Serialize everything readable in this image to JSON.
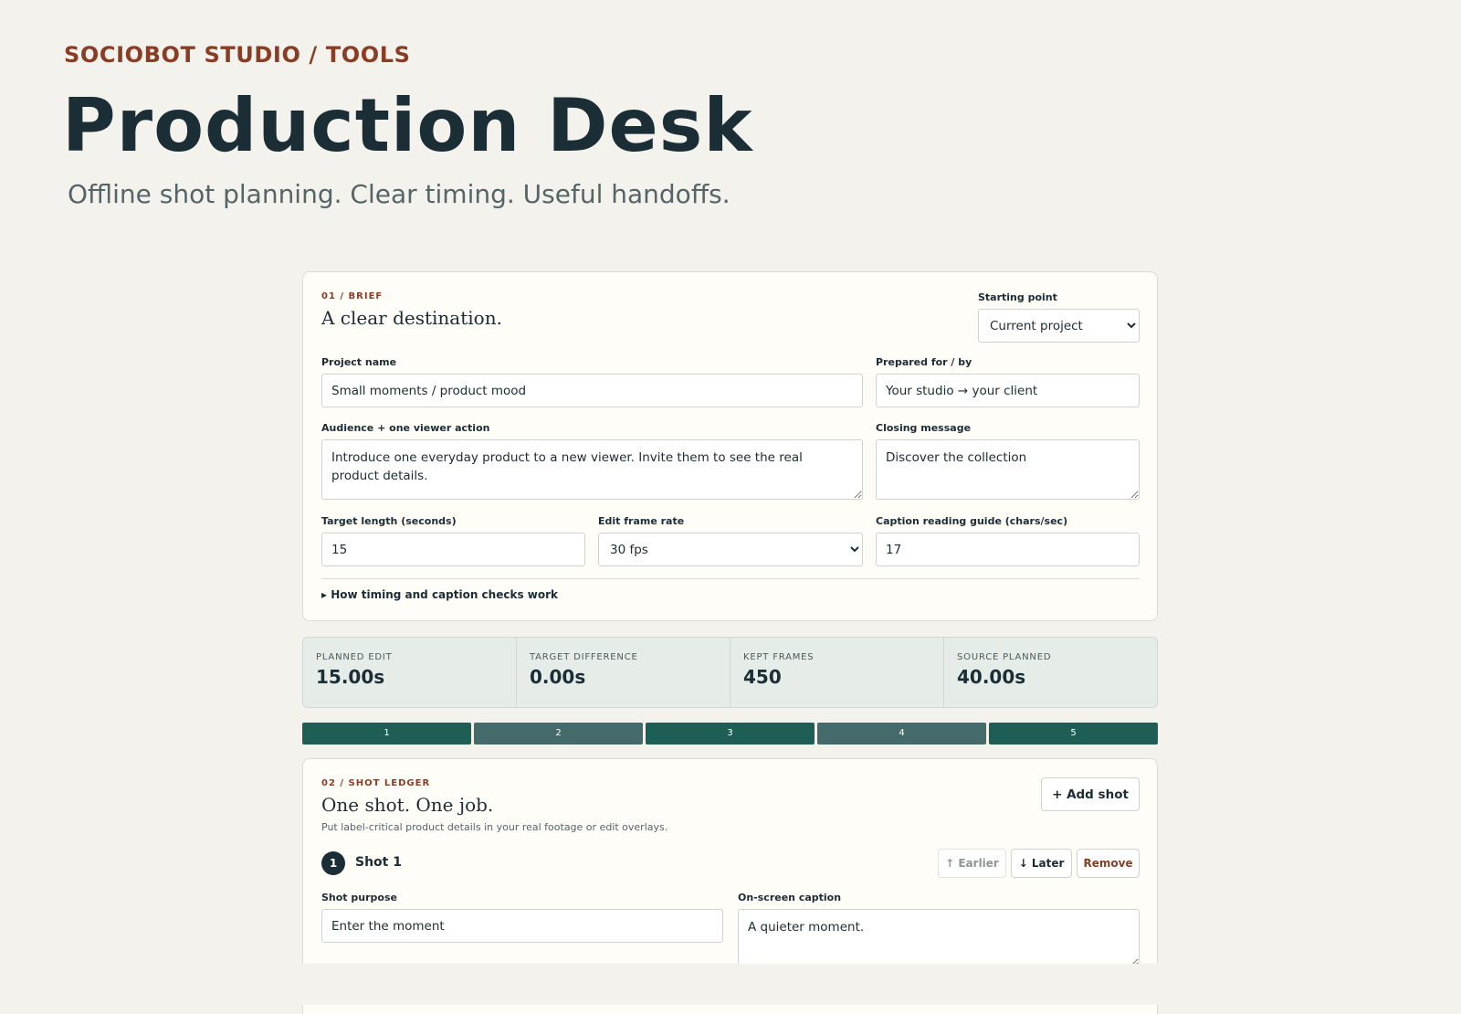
{
  "header": {
    "eyebrow": "SOCIOBOT STUDIO / TOOLS",
    "title": "Production Desk",
    "subtitle": "Offline shot planning. Clear timing. Useful handoffs."
  },
  "brief": {
    "section_label": "01 / BRIEF",
    "heading": "A clear destination.",
    "starting_point": {
      "label": "Starting point",
      "value": "Current project"
    },
    "project_name": {
      "label": "Project name",
      "value": "Small moments / product mood"
    },
    "prepared": {
      "label": "Prepared for / by",
      "value": "Your studio → your client"
    },
    "audience": {
      "label": "Audience + one viewer action",
      "value": "Introduce one everyday product to a new viewer. Invite them to see the real product details."
    },
    "closing": {
      "label": "Closing message",
      "value": "Discover the collection"
    },
    "target_length": {
      "label": "Target length (seconds)",
      "value": "15"
    },
    "frame_rate": {
      "label": "Edit frame rate",
      "value": "30 fps"
    },
    "caption_guide": {
      "label": "Caption reading guide (chars/sec)",
      "value": "17"
    },
    "details_toggle": "▸ How timing and caption checks work"
  },
  "stats": [
    {
      "label": "PLANNED EDIT",
      "value": "15.00s"
    },
    {
      "label": "TARGET DIFFERENCE",
      "value": "0.00s"
    },
    {
      "label": "KEPT FRAMES",
      "value": "450"
    },
    {
      "label": "SOURCE PLANNED",
      "value": "40.00s"
    }
  ],
  "timeline": {
    "segments": [
      {
        "label": "1",
        "color": "#1e5e54"
      },
      {
        "label": "2",
        "color": "#456a6c"
      },
      {
        "label": "3",
        "color": "#1e5e54"
      },
      {
        "label": "4",
        "color": "#456a6c"
      },
      {
        "label": "5",
        "color": "#1e5e54"
      }
    ]
  },
  "ledger": {
    "section_label": "02 / SHOT LEDGER",
    "heading": "One shot. One job.",
    "note": "Put label-critical product details in your real footage or edit overlays.",
    "add_shot": "+ Add shot",
    "shot": {
      "number": "1",
      "title": "Shot 1",
      "earlier": "↑ Earlier",
      "later": "↓ Later",
      "remove": "Remove",
      "purpose": {
        "label": "Shot purpose",
        "value": "Enter the moment"
      },
      "caption": {
        "label": "On-screen caption",
        "value": "A quieter moment."
      }
    }
  },
  "colors": {
    "accent": "#8a3d25",
    "ink": "#1b2e36",
    "segment_dark": "#1e5e54",
    "segment_light": "#456a6c"
  }
}
